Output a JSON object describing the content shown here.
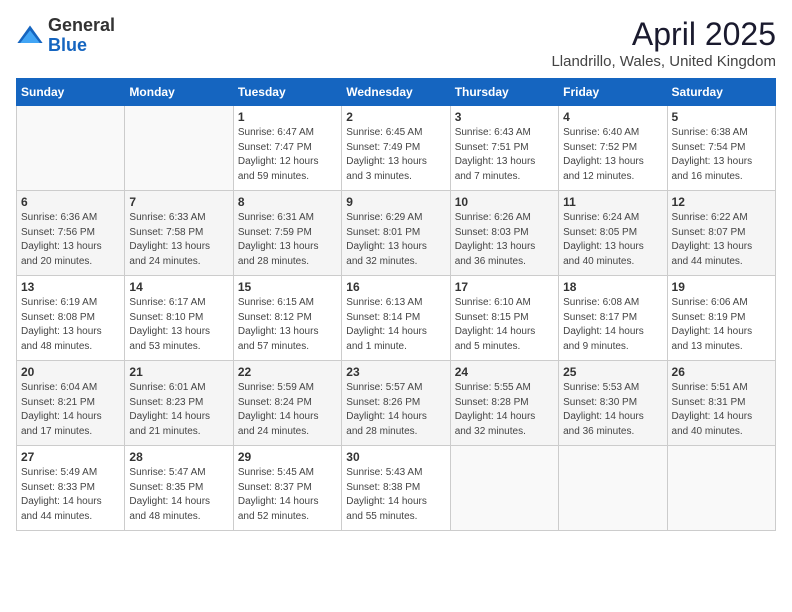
{
  "header": {
    "logo_general": "General",
    "logo_blue": "Blue",
    "month_year": "April 2025",
    "location": "Llandrillo, Wales, United Kingdom"
  },
  "weekdays": [
    "Sunday",
    "Monday",
    "Tuesday",
    "Wednesday",
    "Thursday",
    "Friday",
    "Saturday"
  ],
  "weeks": [
    [
      {
        "day": "",
        "detail": ""
      },
      {
        "day": "",
        "detail": ""
      },
      {
        "day": "1",
        "detail": "Sunrise: 6:47 AM\nSunset: 7:47 PM\nDaylight: 12 hours and 59 minutes."
      },
      {
        "day": "2",
        "detail": "Sunrise: 6:45 AM\nSunset: 7:49 PM\nDaylight: 13 hours and 3 minutes."
      },
      {
        "day": "3",
        "detail": "Sunrise: 6:43 AM\nSunset: 7:51 PM\nDaylight: 13 hours and 7 minutes."
      },
      {
        "day": "4",
        "detail": "Sunrise: 6:40 AM\nSunset: 7:52 PM\nDaylight: 13 hours and 12 minutes."
      },
      {
        "day": "5",
        "detail": "Sunrise: 6:38 AM\nSunset: 7:54 PM\nDaylight: 13 hours and 16 minutes."
      }
    ],
    [
      {
        "day": "6",
        "detail": "Sunrise: 6:36 AM\nSunset: 7:56 PM\nDaylight: 13 hours and 20 minutes."
      },
      {
        "day": "7",
        "detail": "Sunrise: 6:33 AM\nSunset: 7:58 PM\nDaylight: 13 hours and 24 minutes."
      },
      {
        "day": "8",
        "detail": "Sunrise: 6:31 AM\nSunset: 7:59 PM\nDaylight: 13 hours and 28 minutes."
      },
      {
        "day": "9",
        "detail": "Sunrise: 6:29 AM\nSunset: 8:01 PM\nDaylight: 13 hours and 32 minutes."
      },
      {
        "day": "10",
        "detail": "Sunrise: 6:26 AM\nSunset: 8:03 PM\nDaylight: 13 hours and 36 minutes."
      },
      {
        "day": "11",
        "detail": "Sunrise: 6:24 AM\nSunset: 8:05 PM\nDaylight: 13 hours and 40 minutes."
      },
      {
        "day": "12",
        "detail": "Sunrise: 6:22 AM\nSunset: 8:07 PM\nDaylight: 13 hours and 44 minutes."
      }
    ],
    [
      {
        "day": "13",
        "detail": "Sunrise: 6:19 AM\nSunset: 8:08 PM\nDaylight: 13 hours and 48 minutes."
      },
      {
        "day": "14",
        "detail": "Sunrise: 6:17 AM\nSunset: 8:10 PM\nDaylight: 13 hours and 53 minutes."
      },
      {
        "day": "15",
        "detail": "Sunrise: 6:15 AM\nSunset: 8:12 PM\nDaylight: 13 hours and 57 minutes."
      },
      {
        "day": "16",
        "detail": "Sunrise: 6:13 AM\nSunset: 8:14 PM\nDaylight: 14 hours and 1 minute."
      },
      {
        "day": "17",
        "detail": "Sunrise: 6:10 AM\nSunset: 8:15 PM\nDaylight: 14 hours and 5 minutes."
      },
      {
        "day": "18",
        "detail": "Sunrise: 6:08 AM\nSunset: 8:17 PM\nDaylight: 14 hours and 9 minutes."
      },
      {
        "day": "19",
        "detail": "Sunrise: 6:06 AM\nSunset: 8:19 PM\nDaylight: 14 hours and 13 minutes."
      }
    ],
    [
      {
        "day": "20",
        "detail": "Sunrise: 6:04 AM\nSunset: 8:21 PM\nDaylight: 14 hours and 17 minutes."
      },
      {
        "day": "21",
        "detail": "Sunrise: 6:01 AM\nSunset: 8:23 PM\nDaylight: 14 hours and 21 minutes."
      },
      {
        "day": "22",
        "detail": "Sunrise: 5:59 AM\nSunset: 8:24 PM\nDaylight: 14 hours and 24 minutes."
      },
      {
        "day": "23",
        "detail": "Sunrise: 5:57 AM\nSunset: 8:26 PM\nDaylight: 14 hours and 28 minutes."
      },
      {
        "day": "24",
        "detail": "Sunrise: 5:55 AM\nSunset: 8:28 PM\nDaylight: 14 hours and 32 minutes."
      },
      {
        "day": "25",
        "detail": "Sunrise: 5:53 AM\nSunset: 8:30 PM\nDaylight: 14 hours and 36 minutes."
      },
      {
        "day": "26",
        "detail": "Sunrise: 5:51 AM\nSunset: 8:31 PM\nDaylight: 14 hours and 40 minutes."
      }
    ],
    [
      {
        "day": "27",
        "detail": "Sunrise: 5:49 AM\nSunset: 8:33 PM\nDaylight: 14 hours and 44 minutes."
      },
      {
        "day": "28",
        "detail": "Sunrise: 5:47 AM\nSunset: 8:35 PM\nDaylight: 14 hours and 48 minutes."
      },
      {
        "day": "29",
        "detail": "Sunrise: 5:45 AM\nSunset: 8:37 PM\nDaylight: 14 hours and 52 minutes."
      },
      {
        "day": "30",
        "detail": "Sunrise: 5:43 AM\nSunset: 8:38 PM\nDaylight: 14 hours and 55 minutes."
      },
      {
        "day": "",
        "detail": ""
      },
      {
        "day": "",
        "detail": ""
      },
      {
        "day": "",
        "detail": ""
      }
    ]
  ]
}
